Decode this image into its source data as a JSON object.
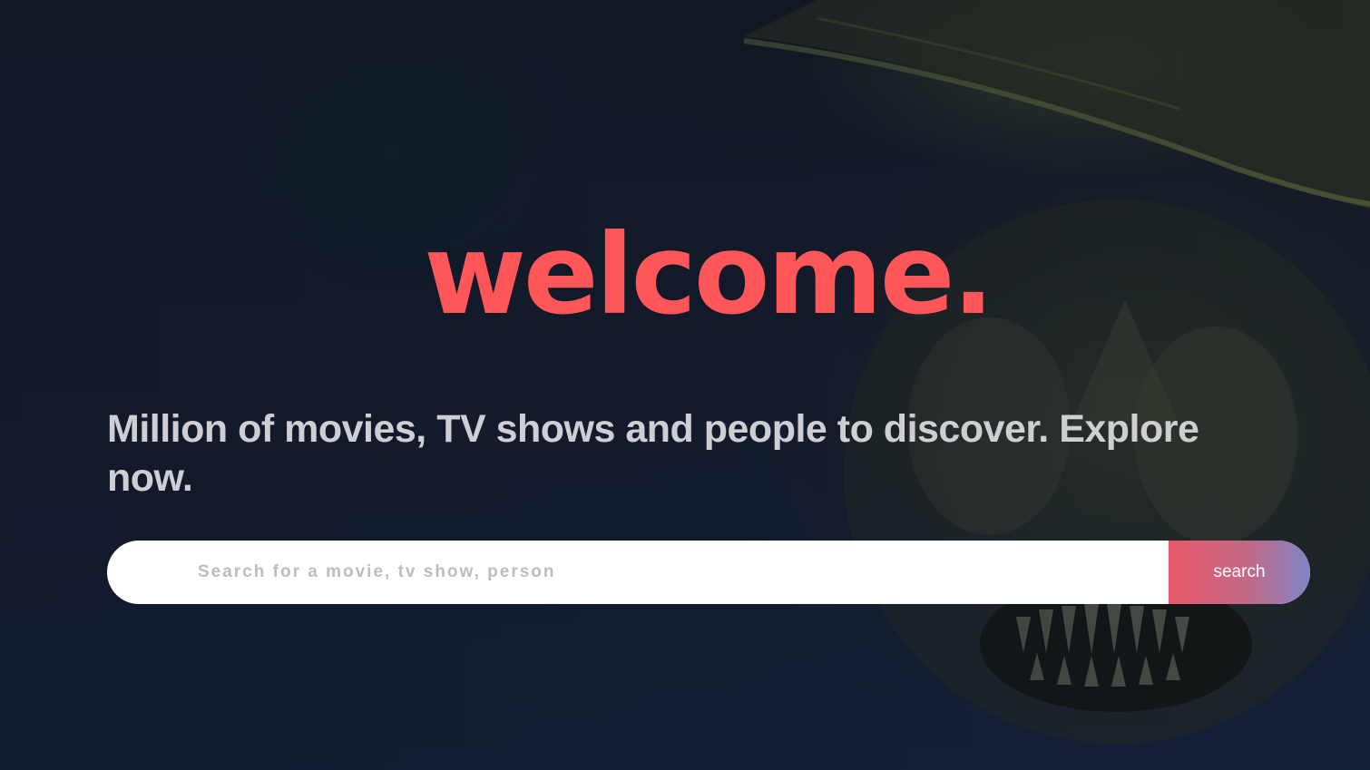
{
  "hero": {
    "title": "welcome.",
    "subtitle": "Million of movies, TV shows and people to discover. Explore now."
  },
  "search": {
    "placeholder": "Search for a movie, tv show, person",
    "value": "",
    "button_label": "search"
  },
  "colors": {
    "title": "#ff5659",
    "background": "#0f1626",
    "button_gradient_start": "#e85a6b",
    "button_gradient_end": "#7f86c8"
  }
}
